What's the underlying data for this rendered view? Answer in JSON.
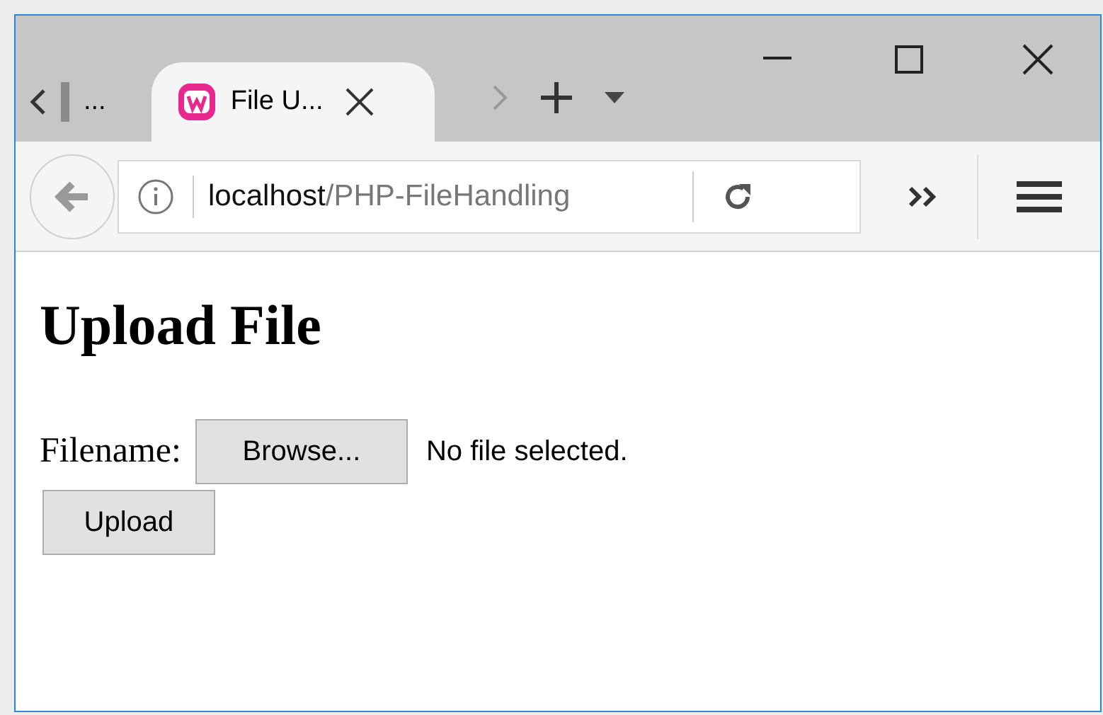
{
  "tabs": [
    {
      "label": "...",
      "selected": false
    },
    {
      "label": "File U...",
      "selected": true
    }
  ],
  "address_bar": {
    "host": "localhost",
    "path": "/PHP-FileHandling"
  },
  "page": {
    "heading": "Upload File",
    "field_label": "Filename:",
    "browse_button": "Browse...",
    "file_status": "No file selected.",
    "submit_button": "Upload"
  }
}
